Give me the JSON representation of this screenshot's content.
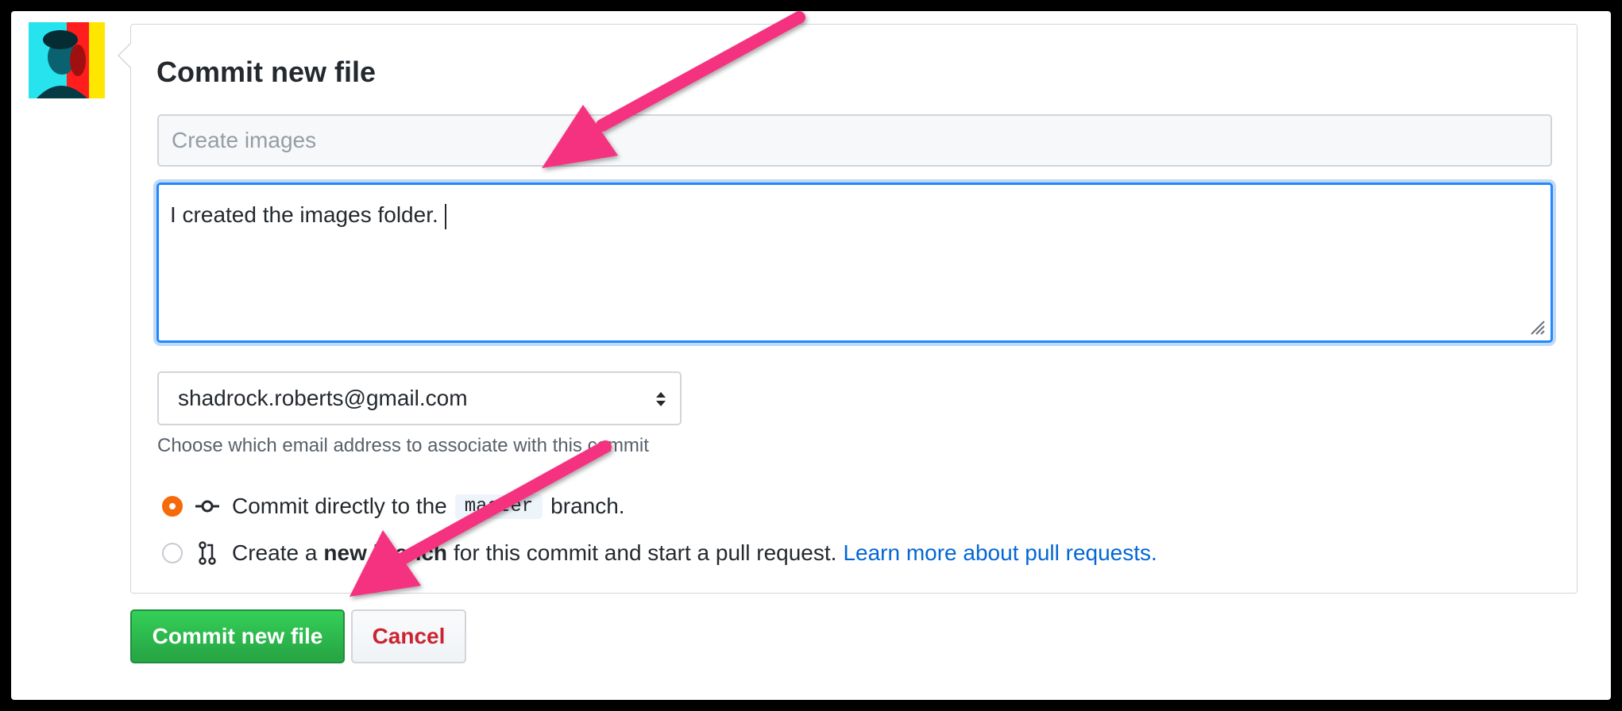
{
  "panel": {
    "title": "Commit new file"
  },
  "summary": {
    "placeholder": "Create images"
  },
  "description": {
    "value": "I created the images folder."
  },
  "email": {
    "selected": "shadrock.roberts@gmail.com",
    "hint": "Choose which email address to associate with this commit"
  },
  "options": {
    "direct": {
      "prefix": "Commit directly to the",
      "branch": "master",
      "suffix": "branch.",
      "checked": true
    },
    "new_branch": {
      "prefix": "Create a",
      "bold": "new branch",
      "suffix": "for this commit and start a pull request.",
      "link": "Learn more about pull requests.",
      "checked": false
    }
  },
  "buttons": {
    "commit": "Commit new file",
    "cancel": "Cancel"
  },
  "colors": {
    "accent_arrow": "#f5317f",
    "commit_green": "#28a745",
    "link_blue": "#0366d6",
    "radio_orange": "#f66a0a",
    "cancel_red": "#cb2431"
  },
  "icons": {
    "avatar": "user-avatar",
    "commit": "git-commit-icon",
    "pull_request": "git-pull-request-icon",
    "select": "select-arrows-icon",
    "resize": "resize-grip-icon"
  }
}
